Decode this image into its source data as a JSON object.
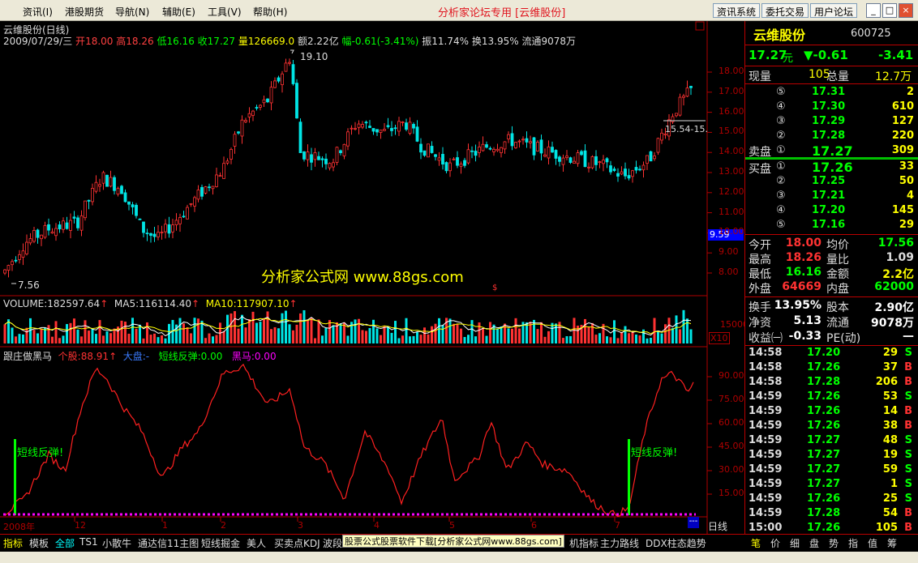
{
  "menu": {
    "items": [
      "资讯(I)",
      "港股期货",
      "导航(N)",
      "辅助(E)",
      "工具(V)",
      "帮助(H)"
    ],
    "app_title": "分析家论坛专用 [云维股份]",
    "buttons": [
      "资讯系统",
      "委托交易",
      "用户论坛"
    ]
  },
  "chart_header": {
    "title": "云维股份(日线)",
    "date": "2009/07/29/三",
    "open_label": "开",
    "open": "18.00",
    "high_label": "高",
    "high": "18.26",
    "low_label": "低",
    "low": "16.16",
    "close_label": "收",
    "close": "17.27",
    "vol_label": "量",
    "vol": "126669.0",
    "amount_label": "额",
    "amount": "2.22亿",
    "change_label": "幅",
    "change": "-0.61(-3.41%)",
    "amplitude_label": "振",
    "amplitude": "11.74%",
    "turnover_label": "换",
    "turnover": "13.95%",
    "float_label": "流通",
    "float": "9078万"
  },
  "annotations": {
    "high_point": "19.10",
    "low_point": "7.56",
    "range_label": "15.54-15.",
    "current_price_tag": "9.59",
    "watermark": "分析家公式网 www.88gs.com",
    "dollar": "$"
  },
  "volume_header": {
    "volume": "VOLUME:182597.64",
    "ma5": "MA5:116114.40",
    "ma10": "MA10:117907.10",
    "scale_label": "X10"
  },
  "indicator_header": {
    "name": "跟庄做黑马",
    "gen": "个股:88.91",
    "dapan": "大盘:-",
    "rebound": "短线反弹:0.00",
    "heima": "黑马:0.00"
  },
  "signals": [
    "短线反弹!",
    "短线反弹!"
  ],
  "price_axis": [
    "18.00",
    "17.00",
    "16.00",
    "15.00",
    "14.00",
    "13.00",
    "12.00",
    "11.00",
    "10.00",
    "9.00",
    "8.00"
  ],
  "volume_axis": [
    "15000"
  ],
  "indicator_axis": [
    "90.00",
    "75.00",
    "60.00",
    "45.00",
    "30.00",
    "15.00"
  ],
  "time_axis": [
    "2008年",
    "12",
    "2009年",
    "1",
    "2",
    "3",
    "4",
    "5",
    "6",
    "7"
  ],
  "colors": {
    "up": "#ff3232",
    "down": "#00e5e5",
    "ma5": "#ffffff",
    "ma10": "#ffff00",
    "axis": "#b00000",
    "indicator": "#ff2020",
    "signal": "#00ff00",
    "heima": "#ff00ff"
  },
  "quote": {
    "name": "云维股份",
    "code": "600725",
    "price": "17.27",
    "unit": "元",
    "change": "▼-0.61",
    "pct": "-3.41",
    "xianliang_label": "现量",
    "xianliang": "105",
    "zongliang_label": "总量",
    "zongliang": "12.7万",
    "sell_label": "卖盘",
    "buy_label": "买盘",
    "asks": [
      {
        "level": "⑤",
        "price": "17.31",
        "vol": "2"
      },
      {
        "level": "④",
        "price": "17.30",
        "vol": "610"
      },
      {
        "level": "③",
        "price": "17.29",
        "vol": "127"
      },
      {
        "level": "②",
        "price": "17.28",
        "vol": "220"
      },
      {
        "level": "①",
        "price": "17.27",
        "vol": "309"
      }
    ],
    "bids": [
      {
        "level": "①",
        "price": "17.26",
        "vol": "33"
      },
      {
        "level": "②",
        "price": "17.25",
        "vol": "50"
      },
      {
        "level": "③",
        "price": "17.21",
        "vol": "4"
      },
      {
        "level": "④",
        "price": "17.20",
        "vol": "145"
      },
      {
        "level": "⑤",
        "price": "17.16",
        "vol": "29"
      }
    ],
    "stats": [
      {
        "l1": "今开",
        "v1": "18.00",
        "l2": "均价",
        "v2": "17.56"
      },
      {
        "l1": "最高",
        "v1": "18.26",
        "l2": "量比",
        "v2": "1.09"
      },
      {
        "l1": "最低",
        "v1": "16.16",
        "l2": "金额",
        "v2": "2.2亿"
      },
      {
        "l1": "外盘",
        "v1": "64669",
        "l2": "内盘",
        "v2": "62000"
      }
    ],
    "stats2": [
      {
        "l1": "换手",
        "v1": "13.95%",
        "l2": "股本",
        "v2": "2.90亿"
      },
      {
        "l1": "净资",
        "v1": "5.13",
        "l2": "流通",
        "v2": "9078万"
      },
      {
        "l1": "收益㈠",
        "v1": "-0.33",
        "l2": "PE(动)",
        "v2": "—"
      }
    ],
    "ticks": [
      {
        "t": "14:58",
        "p": "17.20",
        "v": "29",
        "d": "S"
      },
      {
        "t": "14:58",
        "p": "17.26",
        "v": "37",
        "d": "B"
      },
      {
        "t": "14:58",
        "p": "17.28",
        "v": "206",
        "d": "B"
      },
      {
        "t": "14:59",
        "p": "17.26",
        "v": "53",
        "d": "S"
      },
      {
        "t": "14:59",
        "p": "17.26",
        "v": "14",
        "d": "B"
      },
      {
        "t": "14:59",
        "p": "17.26",
        "v": "38",
        "d": "B"
      },
      {
        "t": "14:59",
        "p": "17.27",
        "v": "48",
        "d": "S"
      },
      {
        "t": "14:59",
        "p": "17.27",
        "v": "19",
        "d": "S"
      },
      {
        "t": "14:59",
        "p": "17.27",
        "v": "59",
        "d": "S"
      },
      {
        "t": "14:59",
        "p": "17.27",
        "v": "1",
        "d": "S"
      },
      {
        "t": "14:59",
        "p": "17.26",
        "v": "25",
        "d": "S"
      },
      {
        "t": "14:59",
        "p": "17.28",
        "v": "54",
        "d": "B"
      },
      {
        "t": "15:00",
        "p": "17.26",
        "v": "105",
        "d": "B"
      }
    ],
    "day_label": "日线"
  },
  "bottom_tabs": [
    "指标",
    "模板",
    "全部",
    "TS1",
    "小散牛",
    "通达信11主图",
    "短线掘金",
    "美人",
    "买卖点KDJ",
    "波段",
    "机指标",
    "主力路线",
    "DDX柱态趋势"
  ],
  "banner": "股票公式股票软件下载[分析家公式网www.88gs.com]",
  "panel_tabs": [
    "笔",
    "价",
    "细",
    "盘",
    "势",
    "指",
    "值",
    "筹"
  ]
}
